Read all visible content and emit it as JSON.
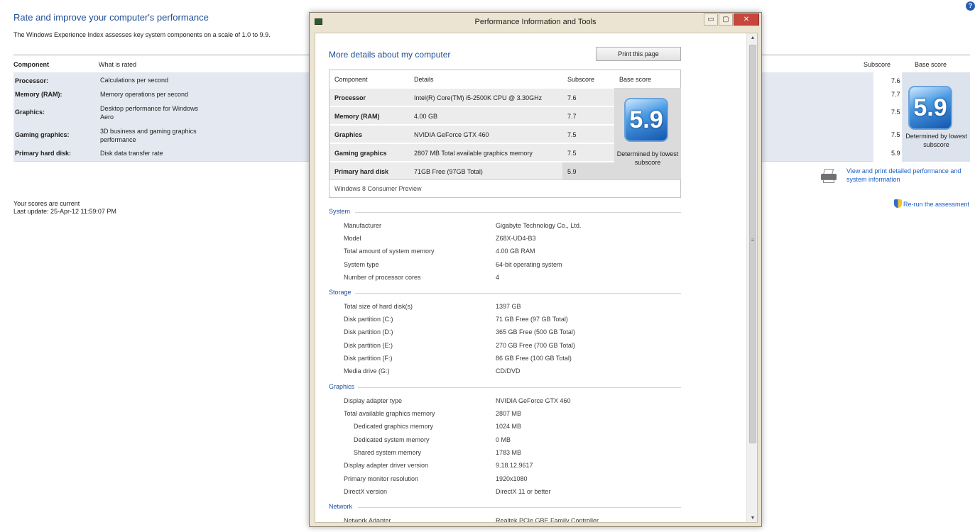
{
  "background": {
    "title": "Rate and improve your computer's performance",
    "subtitle": "The Windows Experience Index assesses key system components on a scale of 1.0 to 9.9.",
    "help_glyph": "?",
    "columns": {
      "component": "Component",
      "what_rated": "What is rated",
      "subscore": "Subscore",
      "base_score": "Base score"
    },
    "rows": [
      {
        "label": "Processor:",
        "desc": "Calculations per second",
        "subscore": "7.6"
      },
      {
        "label": "Memory (RAM):",
        "desc": "Memory operations per second",
        "subscore": "7.7"
      },
      {
        "label": "Graphics:",
        "desc": "Desktop performance for Windows Aero",
        "subscore": "7.5"
      },
      {
        "label": "Gaming graphics:",
        "desc": "3D business and gaming graphics performance",
        "subscore": "7.5"
      },
      {
        "label": "Primary hard disk:",
        "desc": "Disk data transfer rate",
        "subscore": "5.9"
      }
    ],
    "base_score": "5.9",
    "base_caption": "Determined by lowest subscore",
    "status_line1": "Your scores are current",
    "status_line2": "Last update: 25-Apr-12 11:59:07 PM",
    "print_link": "View and print detailed performance and system information",
    "rerun_link": "Re-run the assessment"
  },
  "dialog": {
    "title": "Performance Information and Tools",
    "controls": {
      "minimize": "▭",
      "maximize": "▢",
      "close": "✕"
    },
    "heading": "More details about my computer",
    "print_button": "Print this page",
    "score_table": {
      "headers": {
        "component": "Component",
        "details": "Details",
        "subscore": "Subscore",
        "base_score": "Base score"
      },
      "rows": [
        {
          "label": "Processor",
          "details": "Intel(R) Core(TM) i5-2500K CPU @ 3.30GHz",
          "subscore": "7.6"
        },
        {
          "label": "Memory (RAM)",
          "details": "4.00 GB",
          "subscore": "7.7"
        },
        {
          "label": "Graphics",
          "details": "NVIDIA GeForce GTX 460",
          "subscore": "7.5"
        },
        {
          "label": "Gaming graphics",
          "details": "2807 MB Total available graphics memory",
          "subscore": "7.5"
        },
        {
          "label": "Primary hard disk",
          "details": "71GB Free (97GB Total)",
          "subscore": "5.9"
        }
      ],
      "base_score": "5.9",
      "base_caption": "Determined by lowest subscore",
      "footer": "Windows 8 Consumer Preview"
    },
    "sections": {
      "system": {
        "title": "System",
        "items": [
          {
            "label": "Manufacturer",
            "value": "Gigabyte Technology Co., Ltd."
          },
          {
            "label": "Model",
            "value": "Z68X-UD4-B3"
          },
          {
            "label": "Total amount of system memory",
            "value": "4.00 GB RAM"
          },
          {
            "label": "System type",
            "value": "64-bit operating system"
          },
          {
            "label": "Number of processor cores",
            "value": "4"
          }
        ]
      },
      "storage": {
        "title": "Storage",
        "items": [
          {
            "label": "Total size of hard disk(s)",
            "value": "1397 GB"
          },
          {
            "label": "Disk partition (C:)",
            "value": "71 GB Free (97 GB Total)"
          },
          {
            "label": "Disk partition (D:)",
            "value": "365 GB Free (500 GB Total)"
          },
          {
            "label": "Disk partition (E:)",
            "value": "270 GB Free (700 GB Total)"
          },
          {
            "label": "Disk partition (F:)",
            "value": "86 GB Free (100 GB Total)"
          },
          {
            "label": "Media drive (G:)",
            "value": "CD/DVD"
          }
        ]
      },
      "graphics": {
        "title": "Graphics",
        "items": [
          {
            "label": "Display adapter type",
            "value": "NVIDIA GeForce GTX 460"
          },
          {
            "label": "Total available graphics memory",
            "value": "2807 MB"
          },
          {
            "label": "Dedicated graphics memory",
            "value": "1024 MB"
          },
          {
            "label": "Dedicated system memory",
            "value": "0 MB"
          },
          {
            "label": "Shared system memory",
            "value": "1783 MB"
          },
          {
            "label": "Display adapter driver version",
            "value": "9.18.12.9617"
          },
          {
            "label": "Primary monitor resolution",
            "value": "1920x1080"
          },
          {
            "label": "DirectX version",
            "value": "DirectX 11 or better"
          }
        ]
      },
      "network": {
        "title": "Network",
        "items": [
          {
            "label": "Network Adapter",
            "value": "Realtek PCIe GBE Family Controller"
          }
        ]
      }
    },
    "scrollbar": {
      "up": "▲",
      "down": "▼",
      "grip": "≡"
    }
  },
  "colors": {
    "accent": "#1e4e96",
    "link": "#1a5ec4",
    "close_button": "#c9463d"
  },
  "icons": [
    "help-icon",
    "app-icon",
    "printer-icon",
    "shield-icon",
    "score-badge"
  ]
}
